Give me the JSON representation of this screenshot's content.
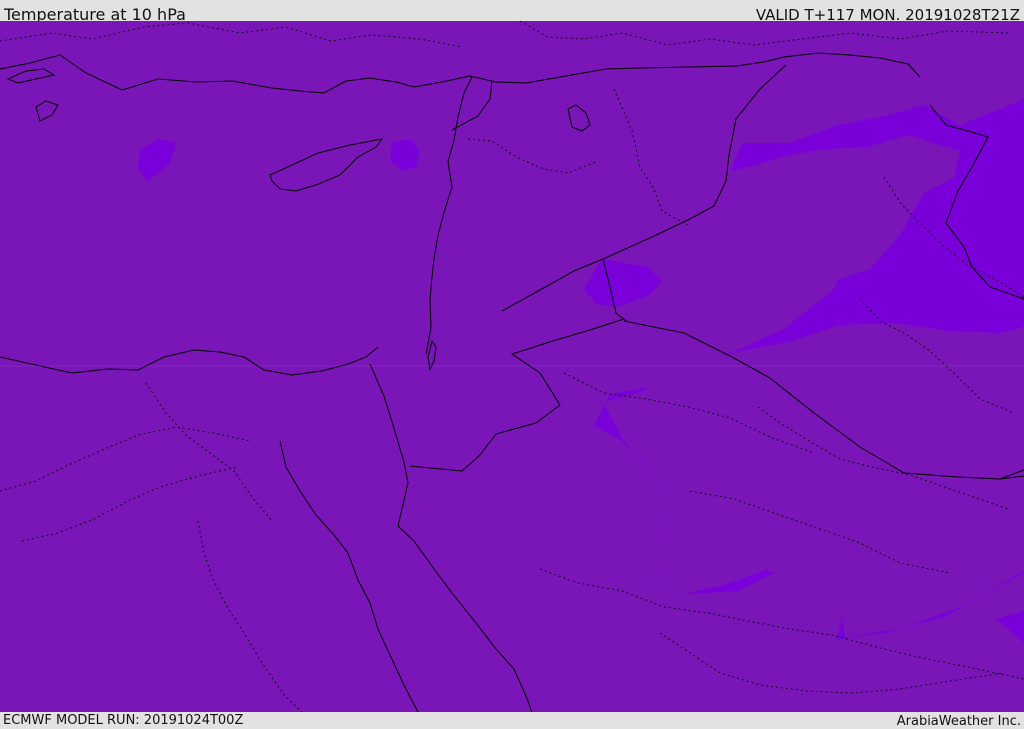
{
  "header": {
    "title": "Temperature at 10 hPa",
    "valid_time": "VALID T+117 MON. 20191028T21Z"
  },
  "footer": {
    "model_run": "ECMWF MODEL RUN: 20191024T00Z",
    "credit": "ArabiaWeather Inc."
  },
  "colors": {
    "base_purple": "#7a00d9",
    "dark_purple": "#7a16b7",
    "border": "#000000",
    "frame": "#e2e2e2"
  }
}
